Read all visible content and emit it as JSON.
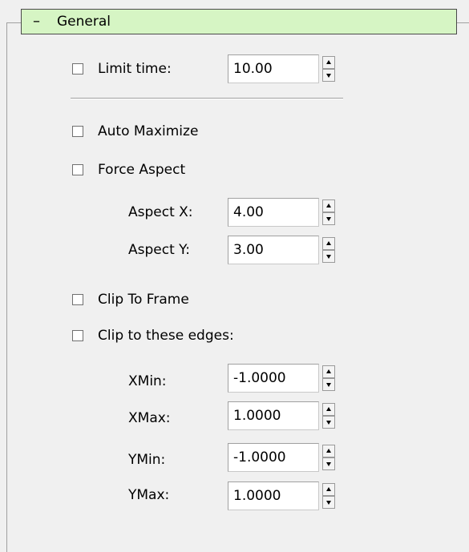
{
  "rollout": {
    "collapse_sign": "–",
    "title": "General"
  },
  "limit_time": {
    "label": "Limit time:",
    "value": "10.00"
  },
  "auto_maximize": {
    "label": "Auto Maximize"
  },
  "force_aspect": {
    "label": "Force Aspect"
  },
  "aspect_x": {
    "label": "Aspect X:",
    "value": "4.00"
  },
  "aspect_y": {
    "label": "Aspect Y:",
    "value": "3.00"
  },
  "clip_to_frame": {
    "label": "Clip To Frame"
  },
  "clip_edges": {
    "label": "Clip to these edges:"
  },
  "xmin": {
    "label": "XMin:",
    "value": "-1.0000"
  },
  "xmax": {
    "label": "XMax:",
    "value": "1.0000"
  },
  "ymin": {
    "label": "YMin:",
    "value": "-1.0000"
  },
  "ymax": {
    "label": "YMax:",
    "value": "1.0000"
  }
}
